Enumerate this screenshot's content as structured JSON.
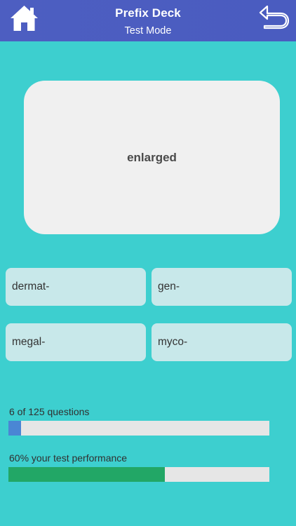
{
  "header": {
    "title": "Prefix Deck",
    "subtitle": "Test Mode",
    "home_icon": "home-icon",
    "back_icon": "back-arrow-icon"
  },
  "card": {
    "term": "enlarged"
  },
  "options": [
    {
      "label": "dermat-"
    },
    {
      "label": "gen-"
    },
    {
      "label": "megal-"
    },
    {
      "label": "myco-"
    }
  ],
  "progress": {
    "questions_text": "6 of 125 questions",
    "questions_fraction": 0.048,
    "performance_text": "60% your test performance",
    "performance_fraction": 0.6
  },
  "colors": {
    "header": "#4d5ec1",
    "background": "#3dcfcf",
    "questions_bar": "#4a86d4",
    "performance_bar": "#22a766"
  }
}
